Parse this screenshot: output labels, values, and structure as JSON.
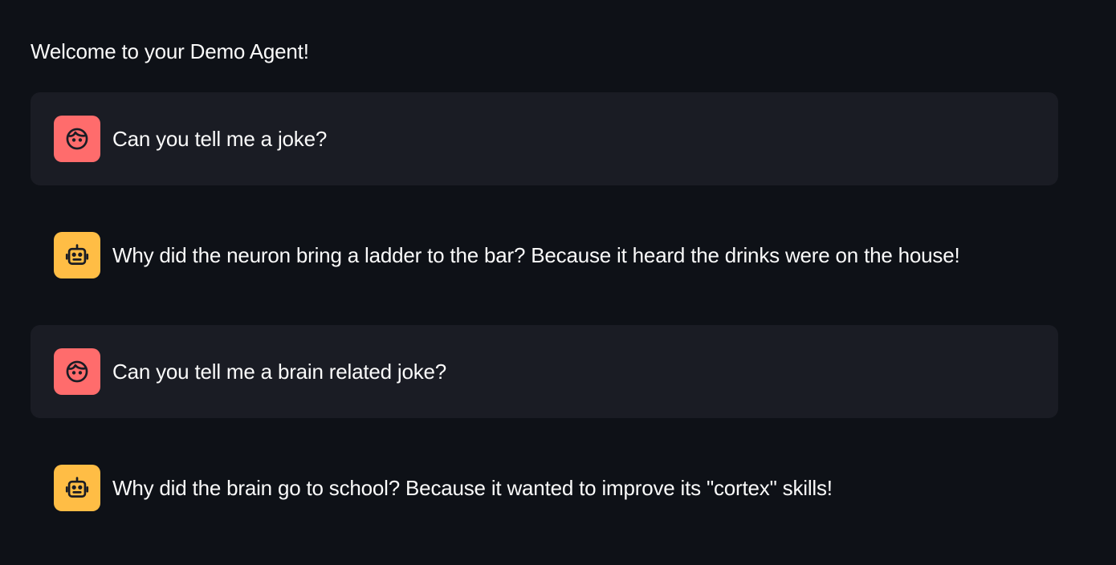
{
  "header": {
    "welcome": "Welcome to your Demo Agent!"
  },
  "colors": {
    "background": "#0e1117",
    "user_bubble": "#1a1c24",
    "user_avatar": "#ff6c6c",
    "assistant_avatar": "#ffbd45",
    "text": "#fafafa"
  },
  "messages": [
    {
      "role": "user",
      "avatar_icon": "user-face-icon",
      "text": "Can you tell me a joke?"
    },
    {
      "role": "assistant",
      "avatar_icon": "robot-icon",
      "text": "Why did the neuron bring a ladder to the bar? Because it heard the drinks were on the house!"
    },
    {
      "role": "user",
      "avatar_icon": "user-face-icon",
      "text": "Can you tell me a brain related joke?"
    },
    {
      "role": "assistant",
      "avatar_icon": "robot-icon",
      "text": "Why did the brain go to school? Because it wanted to improve its \"cortex\" skills!"
    }
  ]
}
